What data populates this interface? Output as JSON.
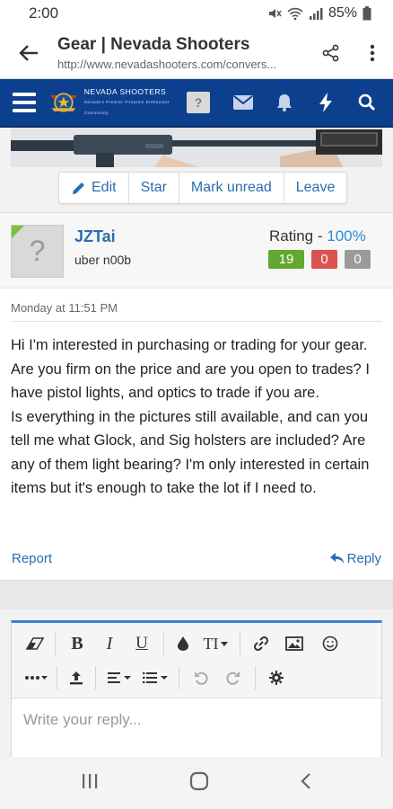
{
  "status_bar": {
    "time": "2:00",
    "battery": "85%"
  },
  "browser": {
    "title": "Gear | Nevada Shooters",
    "url": "http://www.nevadashooters.com/convers..."
  },
  "site": {
    "logo_text": "Nevada Shooters",
    "logo_subtitle": "Nevada's Premier Firearms Enthusiast Community",
    "help_label": "?",
    "nav_color": "#0d3f8f"
  },
  "actions": {
    "edit": "Edit",
    "star": "Star",
    "mark_unread": "Mark unread",
    "leave": "Leave"
  },
  "post": {
    "author": "JZTai",
    "user_title": "uber n00b",
    "avatar_placeholder": "?",
    "rating_label": "Rating -",
    "rating_value": "100%",
    "positive": "19",
    "negative": "0",
    "neutral": "0",
    "date": "Monday at 11:51 PM",
    "paragraphs": [
      "Hi I'm interested in purchasing or trading for your gear. Are you firm on the price and are you open to trades? I have pistol lights, and optics to trade if you are.",
      "Is everything in the pictures still available, and can you tell me what Glock, and Sig holsters are included? Are any of them light bearing? I'm only interested in certain items but it's enough to take the lot if I need to."
    ],
    "report": "Report",
    "reply": "Reply"
  },
  "editor": {
    "placeholder": "Write your reply...",
    "bold": "B",
    "italic": "I",
    "underline": "U",
    "font_size": "TI"
  }
}
